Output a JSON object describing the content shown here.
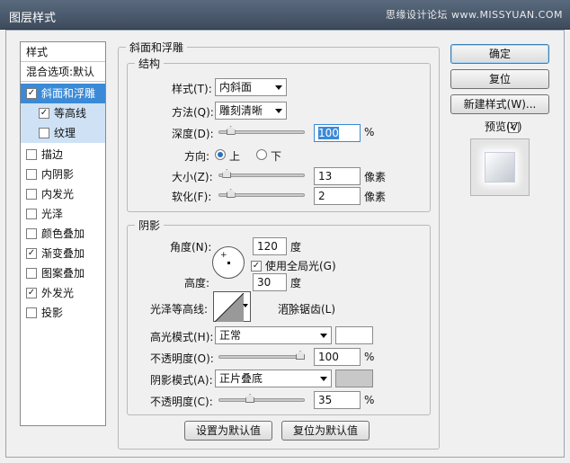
{
  "window": {
    "title": "图层样式",
    "watermark": "思缘设计论坛 www.MISSYUAN.COM"
  },
  "styles_panel": {
    "header": "样式",
    "blend": "混合选项:默认",
    "items": [
      {
        "label": "斜面和浮雕",
        "checked": true
      },
      {
        "label": "等高线",
        "checked": true
      },
      {
        "label": "纹理",
        "checked": false
      },
      {
        "label": "描边",
        "checked": false
      },
      {
        "label": "内阴影",
        "checked": false
      },
      {
        "label": "内发光",
        "checked": false
      },
      {
        "label": "光泽",
        "checked": false
      },
      {
        "label": "颜色叠加",
        "checked": false
      },
      {
        "label": "渐变叠加",
        "checked": true
      },
      {
        "label": "图案叠加",
        "checked": false
      },
      {
        "label": "外发光",
        "checked": true
      },
      {
        "label": "投影",
        "checked": false
      }
    ]
  },
  "bevel": {
    "group_title": "斜面和浮雕",
    "structure": {
      "title": "结构",
      "style_label": "样式(T):",
      "style_value": "内斜面",
      "method_label": "方法(Q):",
      "method_value": "雕刻清晰",
      "depth_label": "深度(D):",
      "depth_value": "100",
      "depth_unit": "%",
      "depth_level": 0.1,
      "direction_label": "方向:",
      "dir_up": "上",
      "dir_down": "下",
      "size_label": "大小(Z):",
      "size_value": "13",
      "size_unit": "像素",
      "size_level": 0.05,
      "soften_label": "软化(F):",
      "soften_value": "2",
      "soften_unit": "像素",
      "soften_level": 0.1
    },
    "shading": {
      "title": "阴影",
      "angle_label": "角度(N):",
      "angle_value": "120",
      "angle_unit": "度",
      "global_light_label": "使用全局光(G)",
      "global_light_checked": true,
      "altitude_label": "高度:",
      "altitude_value": "30",
      "altitude_unit": "度",
      "gloss_label": "光泽等高线:",
      "anti_alias_label": "消除锯齿(L)",
      "anti_alias_checked": false,
      "highlight_label": "高光模式(H):",
      "highlight_mode": "正常",
      "highlight_color": "#ffffff",
      "highlight_opacity_label": "不透明度(O):",
      "highlight_opacity": "100",
      "highlight_opacity_level": 1.0,
      "pct": "%",
      "shadow_label": "阴影模式(A):",
      "shadow_mode": "正片叠底",
      "shadow_color": "#c8c8c8",
      "shadow_opacity_label": "不透明度(C):",
      "shadow_opacity": "35",
      "shadow_opacity_level": 0.35
    },
    "make_default": "设置为默认值",
    "reset_default": "复位为默认值"
  },
  "buttons": {
    "ok": "确定",
    "reset": "复位",
    "new_style": "新建样式(W)...",
    "preview_label": "预览(V)",
    "preview_checked": true
  }
}
